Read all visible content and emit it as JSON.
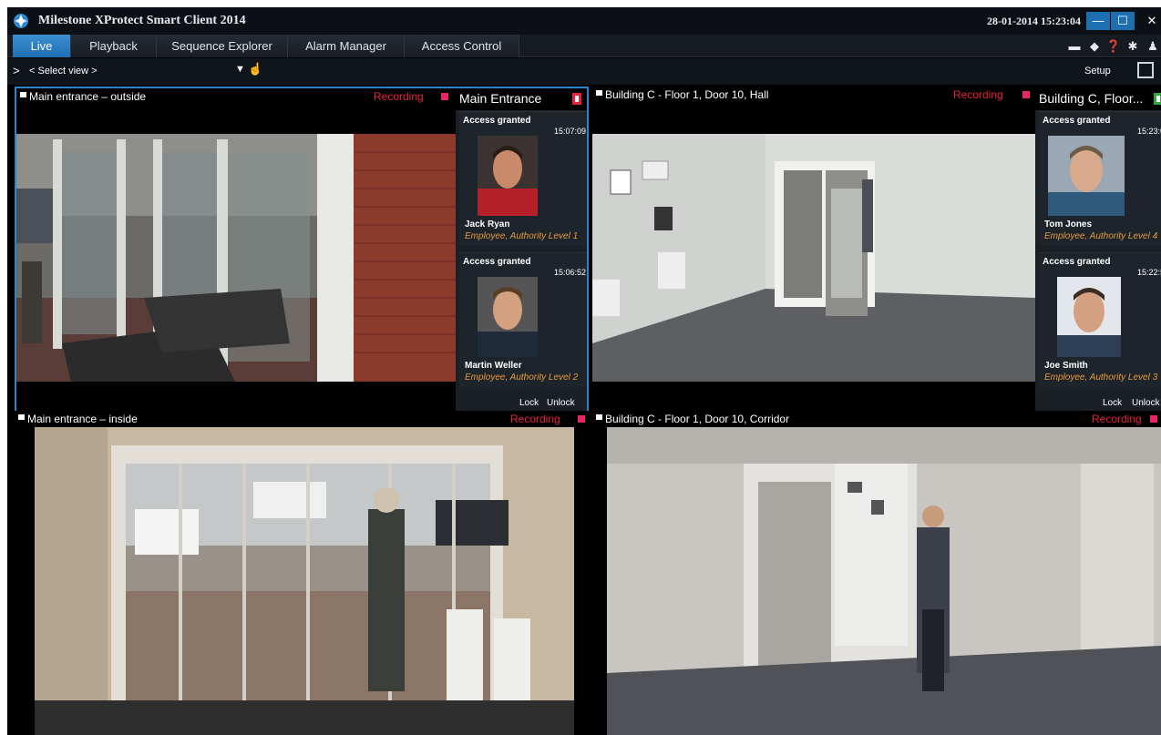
{
  "app": {
    "title": "Milestone XProtect Smart Client 2014",
    "datetime": "28-01-2014 15:23:04"
  },
  "window_controls": {
    "minimize": "—",
    "maximize": "☐",
    "close": "✕"
  },
  "tabs": [
    {
      "label": "Live",
      "active": true
    },
    {
      "label": "Playback"
    },
    {
      "label": "Sequence Explorer"
    },
    {
      "label": "Alarm Manager"
    },
    {
      "label": "Access Control"
    }
  ],
  "toolbar_icons": [
    "monitor-icon",
    "pin-icon",
    "help-icon",
    "settings-icon",
    "user-icon"
  ],
  "view_bar": {
    "chevron": ">",
    "select_view": "< Select view >",
    "dropdown": "▼",
    "setup": "Setup"
  },
  "panes": {
    "top_left": {
      "name": "Main entrance – outside",
      "recording": "Recording"
    },
    "top_right": {
      "name": "Building C - Floor 1, Door 10, Hall",
      "recording": "Recording"
    },
    "bottom_left": {
      "name": "Main entrance – inside",
      "recording": "Recording"
    },
    "bottom_right": {
      "name": "Building C - Floor 1, Door 10, Corridor",
      "recording": "Recording"
    }
  },
  "access_panels": {
    "left": {
      "title": "Main Entrance",
      "events": [
        {
          "status": "Access granted",
          "time": "15:07:09",
          "person": "Jack Ryan",
          "role": "Employee, Authority Level 1"
        },
        {
          "status": "Access granted",
          "time": "15:06:52",
          "person": "Martin Weller",
          "role": "Employee, Authority Level 2"
        }
      ],
      "lock": "Lock",
      "unlock": "Unlock"
    },
    "right": {
      "title": "Building C, Floor...",
      "events": [
        {
          "status": "Access granted",
          "time": "15:23:0",
          "person": "Tom Jones",
          "role": "Employee, Authority Level 4"
        },
        {
          "status": "Access granted",
          "time": "15:22:5",
          "person": "Joe Smith",
          "role": "Employee, Authority Level 3"
        }
      ],
      "lock": "Lock",
      "unlock": "Unlock"
    }
  },
  "colors": {
    "accent": "#2a86c9",
    "recording": "#e5223a",
    "role_text": "#e79a3c"
  }
}
